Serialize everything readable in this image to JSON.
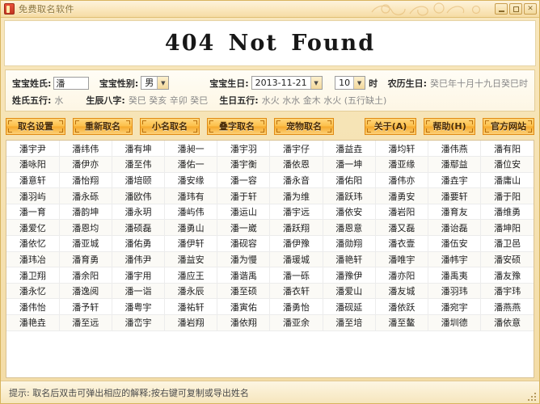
{
  "window": {
    "title": "免费取名软件",
    "icon": "app-icon",
    "controls": {
      "minimize": "–",
      "maximize": "□",
      "close": "✕"
    }
  },
  "banner": {
    "text": "404 Not Found"
  },
  "form": {
    "surname_label": "宝宝姓氏:",
    "surname_value": "潘",
    "surname_placeholder": "姓氏",
    "gender_label": "宝宝性别:",
    "gender_value": "男",
    "birthday_label": "宝宝生日:",
    "birthday_value": "2013-11-21",
    "hour_value": "10",
    "hour_unit": "时",
    "lunar_label": "农历生日:",
    "lunar_value": "癸巳年十月十九日癸巳时",
    "surname_wuxing_label": "姓氏五行:",
    "surname_wuxing_value": "水",
    "bazi_label": "生辰八字:",
    "bazi_value": "癸巳 癸亥 辛卯 癸巳",
    "birth_wuxing_label": "生日五行:",
    "birth_wuxing_value": "水火 水水 金木 水火 (五行缺土)"
  },
  "toolbar": {
    "left_buttons": [
      {
        "label": "取名设置",
        "name": "naming-settings-button"
      },
      {
        "label": "重新取名",
        "name": "rename-button"
      },
      {
        "label": "小名取名",
        "name": "nickname-button"
      },
      {
        "label": "叠字取名",
        "name": "reduplicated-name-button"
      },
      {
        "label": "宠物取名",
        "name": "pet-name-button"
      }
    ],
    "right_buttons": [
      {
        "label": "关于(A)",
        "name": "about-button"
      },
      {
        "label": "帮助(H)",
        "name": "help-button"
      },
      {
        "label": "官方网站",
        "name": "official-website-button"
      }
    ]
  },
  "grid": {
    "columns": 10,
    "rows": [
      [
        "潘宇尹",
        "潘纬伟",
        "潘有坤",
        "潘昶一",
        "潘宇羽",
        "潘宇仔",
        "潘益垚",
        "潘均轩",
        "潘伟燕",
        "潘有阳"
      ],
      [
        "潘咏阳",
        "潘伊亦",
        "潘至伟",
        "潘佑一",
        "潘宇衡",
        "潘依恩",
        "潘一坤",
        "潘亚缘",
        "潘鄢益",
        "潘位安"
      ],
      [
        "潘意轩",
        "潘怡翔",
        "潘培颐",
        "潘安缘",
        "潘一容",
        "潘永音",
        "潘佑阳",
        "潘伟亦",
        "潘垚宇",
        "潘庸山"
      ],
      [
        "潘羽屿",
        "潘永砾",
        "潘欧伟",
        "潘玮有",
        "潘于轩",
        "潘为维",
        "潘跃玮",
        "潘勇安",
        "潘要轩",
        "潘于阳"
      ],
      [
        "潘一育",
        "潘韵坤",
        "潘永玥",
        "潘屿伟",
        "潘运山",
        "潘宇远",
        "潘依安",
        "潘岩阳",
        "潘育友",
        "潘维勇"
      ],
      [
        "潘爱亿",
        "潘恩均",
        "潘硕磊",
        "潘勇山",
        "潘一崴",
        "潘跃翔",
        "潘恩意",
        "潘又磊",
        "潘诒磊",
        "潘坤阳"
      ],
      [
        "潘依忆",
        "潘亚城",
        "潘佑勇",
        "潘伊轩",
        "潘砚容",
        "潘伊豫",
        "潘勋翔",
        "潘衣壹",
        "潘伍安",
        "潘卫邑"
      ],
      [
        "潘玮冶",
        "潘育勇",
        "潘伟尹",
        "潘益安",
        "潘为慢",
        "潘瑗城",
        "潘艳轩",
        "潘唯宇",
        "潘帏宇",
        "潘安硕"
      ],
      [
        "潘卫翔",
        "潘余阳",
        "潘宇用",
        "潘应王",
        "潘谐禹",
        "潘一砾",
        "潘豫伊",
        "潘亦阳",
        "潘禹夷",
        "潘友豫"
      ],
      [
        "潘永忆",
        "潘逸阅",
        "潘一诣",
        "潘永辰",
        "潘至硕",
        "潘衣轩",
        "潘爱山",
        "潘友城",
        "潘羽玮",
        "潘宇玮"
      ],
      [
        "潘伟怡",
        "潘予轩",
        "潘粤宇",
        "潘祐轩",
        "潘寅佑",
        "潘勇怡",
        "潘砚延",
        "潘依跃",
        "潘宛宇",
        "潘燕燕"
      ],
      [
        "潘艳垚",
        "潘至远",
        "潘峦宇",
        "潘岩翔",
        "潘依翔",
        "潘亚余",
        "潘至培",
        "潘至鳌",
        "潘圳德",
        "潘依意"
      ]
    ]
  },
  "statusbar": {
    "hint": "提示: 取名后双击可弹出相应的解释;按右键可复制或导出姓名"
  },
  "colors": {
    "accent": "#f5a92c",
    "titlebar": "#f6dca4",
    "panel": "#fdf6e4"
  }
}
